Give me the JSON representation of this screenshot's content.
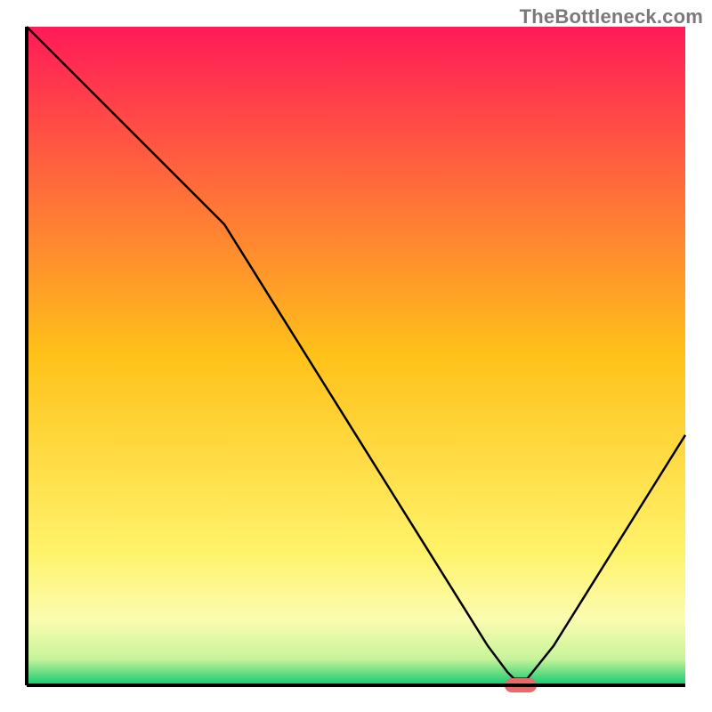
{
  "watermark": "TheBottleneck.com",
  "chart_data": {
    "type": "line",
    "x": [
      0.0,
      0.05,
      0.1,
      0.15,
      0.2,
      0.25,
      0.3,
      0.35,
      0.4,
      0.45,
      0.5,
      0.55,
      0.6,
      0.65,
      0.7,
      0.73,
      0.74,
      0.76,
      0.8,
      0.85,
      0.9,
      0.95,
      1.0
    ],
    "values": [
      1.0,
      0.95,
      0.9,
      0.85,
      0.8,
      0.75,
      0.7,
      0.62,
      0.54,
      0.46,
      0.38,
      0.3,
      0.22,
      0.14,
      0.06,
      0.02,
      0.01,
      0.01,
      0.06,
      0.14,
      0.22,
      0.3,
      0.38
    ],
    "title": "",
    "xlabel": "",
    "ylabel": "",
    "xlim": [
      0,
      1
    ],
    "ylim": [
      0,
      1
    ],
    "marker": {
      "x": 0.75,
      "y": 0.0,
      "color": "#e86a6a"
    },
    "gradient_stops": [
      {
        "offset": 0.0,
        "color": "#ff1a58"
      },
      {
        "offset": 0.5,
        "color": "#ffc21a"
      },
      {
        "offset": 0.8,
        "color": "#fff36b"
      },
      {
        "offset": 0.9,
        "color": "#fbfcb0"
      },
      {
        "offset": 0.96,
        "color": "#c7f49a"
      },
      {
        "offset": 0.99,
        "color": "#3cd47a"
      },
      {
        "offset": 1.0,
        "color": "#14cc72"
      }
    ],
    "axes": {
      "bottom": true,
      "left": true,
      "top_border": false,
      "right_border": false,
      "color": "#000000",
      "width": 4
    }
  }
}
